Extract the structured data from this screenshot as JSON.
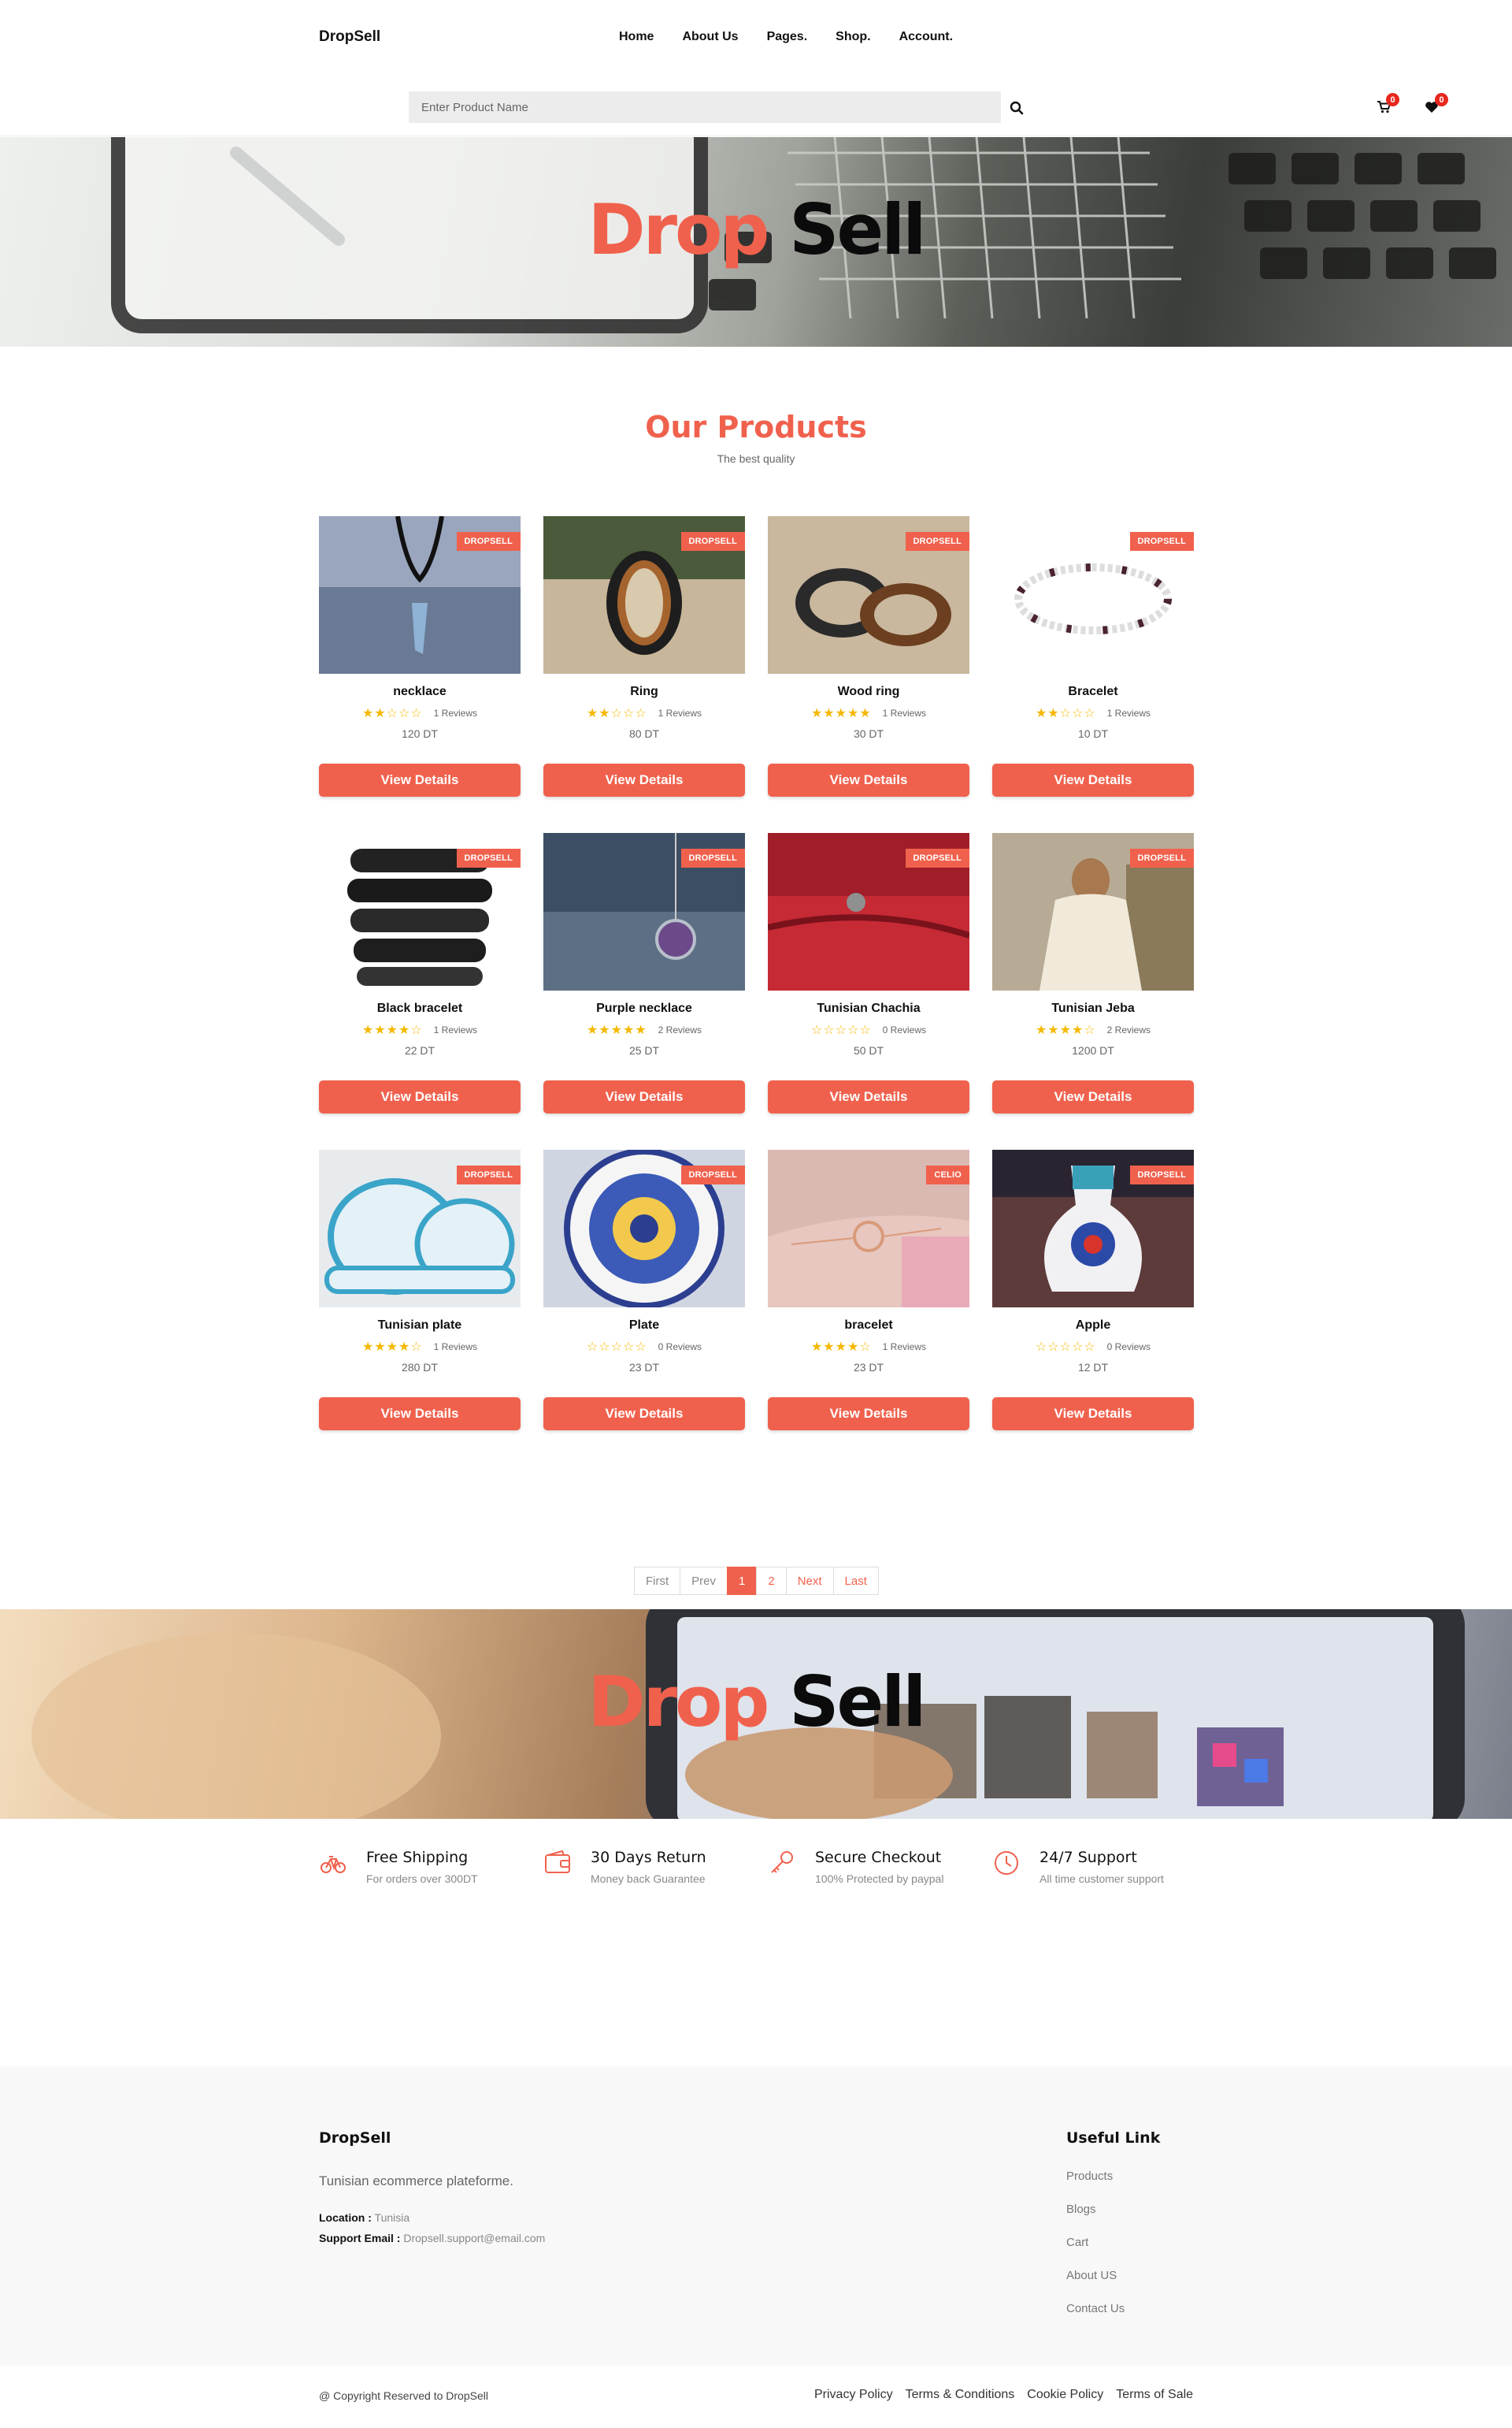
{
  "header": {
    "logo": "DropSell",
    "nav": [
      "Home",
      "About Us",
      "Pages.",
      "Shop.",
      "Account."
    ],
    "search_placeholder": "Enter Product Name",
    "cart_count": "0",
    "wishlist_count": "0"
  },
  "banner": {
    "drop": "Drop",
    "sell": " Sell"
  },
  "products_section": {
    "title": "Our Products",
    "subtitle": "The best quality"
  },
  "products": [
    {
      "name": "necklace",
      "tag": "DROPSELL",
      "rating": 2,
      "reviews": "1 Reviews",
      "price": "120 DT",
      "button": "View Details"
    },
    {
      "name": "Ring",
      "tag": "DROPSELL",
      "rating": 2,
      "reviews": "1 Reviews",
      "price": "80 DT",
      "button": "View Details"
    },
    {
      "name": "Wood ring",
      "tag": "DROPSELL",
      "rating": 5,
      "reviews": "1 Reviews",
      "price": "30 DT",
      "button": "View Details"
    },
    {
      "name": "Bracelet",
      "tag": "DROPSELL",
      "rating": 2,
      "reviews": "1 Reviews",
      "price": "10 DT",
      "button": "View Details"
    },
    {
      "name": "Black bracelet",
      "tag": "DROPSELL",
      "rating": 4,
      "reviews": "1 Reviews",
      "price": "22 DT",
      "button": "View Details"
    },
    {
      "name": "Purple necklace",
      "tag": "DROPSELL",
      "rating": 4.5,
      "reviews": "2 Reviews",
      "price": "25 DT",
      "button": "View Details"
    },
    {
      "name": "Tunisian Chachia",
      "tag": "DROPSELL",
      "rating": 0,
      "reviews": "0 Reviews",
      "price": "50 DT",
      "button": "View Details"
    },
    {
      "name": "Tunisian Jeba",
      "tag": "DROPSELL",
      "rating": 3.5,
      "reviews": "2 Reviews",
      "price": "1200 DT",
      "button": "View Details"
    },
    {
      "name": "Tunisian plate",
      "tag": "DROPSELL",
      "rating": 4,
      "reviews": "1 Reviews",
      "price": "280 DT",
      "button": "View Details"
    },
    {
      "name": "Plate",
      "tag": "DROPSELL",
      "rating": 0,
      "reviews": "0 Reviews",
      "price": "23 DT",
      "button": "View Details"
    },
    {
      "name": "bracelet",
      "tag": "CELIO",
      "rating": 4,
      "reviews": "1 Reviews",
      "price": "23 DT",
      "button": "View Details"
    },
    {
      "name": "Apple",
      "tag": "DROPSELL",
      "rating": 0,
      "reviews": "0 Reviews",
      "price": "12 DT",
      "button": "View Details"
    }
  ],
  "pagination": {
    "first": "First",
    "prev": "Prev",
    "pages": [
      "1",
      "2"
    ],
    "current": "1",
    "next": "Next",
    "last": "Last"
  },
  "features": [
    {
      "icon": "bicycle-icon",
      "title": "Free Shipping",
      "subtitle": "For orders over 300DT"
    },
    {
      "icon": "wallet-icon",
      "title": "30 Days Return",
      "subtitle": "Money back Guarantee"
    },
    {
      "icon": "key-icon",
      "title": "Secure Checkout",
      "subtitle": "100% Protected by paypal"
    },
    {
      "icon": "clock-icon",
      "title": "24/7 Support",
      "subtitle": "All time customer support"
    }
  ],
  "footer": {
    "logo": "DropSell",
    "description": "Tunisian ecommerce plateforme.",
    "location_label": "Location :",
    "location": "Tunisia",
    "email_label": "Support Email :",
    "email": "Dropsell.support@email.com",
    "useful_title": "Useful Link",
    "links": [
      "Products",
      "Blogs",
      "Cart",
      "About US",
      "Contact Us"
    ],
    "copyright": "@ Copyright Reserved to DropSell",
    "policies": [
      "Privacy Policy",
      "Terms & Conditions",
      "Cookie Policy",
      "Terms of Sale"
    ]
  },
  "colors": {
    "accent": "#f0614d",
    "star": "#f5b800",
    "badge": "#e8281f"
  }
}
